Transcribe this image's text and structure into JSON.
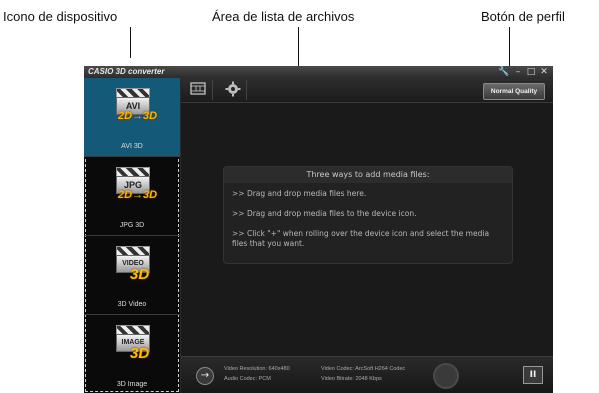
{
  "annotations": {
    "device_icon": "Icono de dispositivo",
    "file_list_area": "Área de lista de archivos",
    "profile_button": "Botón de perfil"
  },
  "app": {
    "title": "CASIO 3D converter",
    "window_controls": [
      "wrench-icon",
      "minimize-icon",
      "maximize-icon",
      "close-icon"
    ]
  },
  "toolbar": {
    "buttons": [
      "film-strip-icon",
      "gear-icon"
    ],
    "quality_label": "Normal Quality"
  },
  "devices": [
    {
      "label": "AVI 3D",
      "format": "AVI",
      "badge": "2D→3D",
      "selected": true
    },
    {
      "label": "JPG 3D",
      "format": "JPG",
      "badge": "2D→3D",
      "selected": false
    },
    {
      "label": "3D Video",
      "format": "VIDEO",
      "badge": "3D",
      "selected": false
    },
    {
      "label": "3D Image",
      "format": "IMAGE",
      "badge": "3D",
      "selected": false
    }
  ],
  "info": {
    "title": "Three ways to add media files:",
    "line1": ">>  Drag and drop media files here.",
    "line2": ">>  Drag and drop media files to the device icon.",
    "line3": ">>  Click \"+\" when rolling over the device icon and select the media files that you want."
  },
  "status": {
    "video_resolution": "Video Resolution: 640x480",
    "audio_codec": "Audio Codec: PCM",
    "video_codec": "Video Codec: ArcSoft H264 Codec",
    "video_bitrate": "Video Bitrate: 2048 Kbps",
    "pause_label": "II"
  },
  "colors": {
    "selected_bg": "#145a78",
    "badge": "#ffc000",
    "window_bg": "#141414"
  }
}
